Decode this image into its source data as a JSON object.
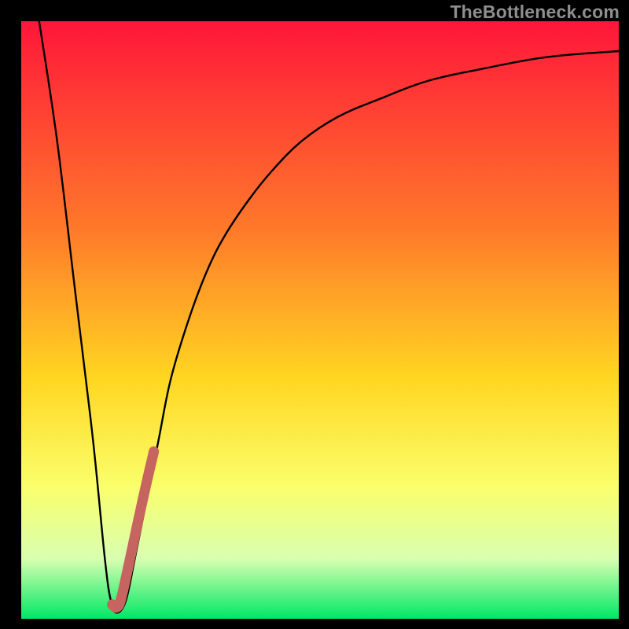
{
  "watermark": "TheBottleneck.com",
  "colors": {
    "frame": "#000000",
    "gradient_top": "#ff163a",
    "gradient_mid1": "#ff7a2a",
    "gradient_mid2": "#ffd722",
    "gradient_mid3": "#faff6c",
    "gradient_mid4": "#d8ffb0",
    "gradient_bottom": "#00e865",
    "curve_main": "#000000",
    "curve_highlight": "#c66460"
  },
  "chart_data": {
    "type": "line",
    "title": "",
    "xlabel": "",
    "ylabel": "",
    "xlim": [
      0,
      100
    ],
    "ylim": [
      0,
      100
    ],
    "grid": false,
    "legend": false,
    "series": [
      {
        "name": "main-curve",
        "color": "#000000",
        "x": [
          3,
          6,
          9,
          12,
          14,
          15,
          16,
          17.5,
          19,
          21,
          23,
          25,
          28,
          31,
          34,
          38,
          42,
          47,
          53,
          60,
          68,
          77,
          88,
          100
        ],
        "y": [
          100,
          80,
          55,
          30,
          10,
          3,
          1,
          3,
          10,
          20,
          30,
          40,
          50,
          58,
          64,
          70,
          75,
          80,
          84,
          87,
          90,
          92,
          94,
          95
        ]
      },
      {
        "name": "highlight-segment",
        "color": "#c66460",
        "x": [
          15.2,
          15.6,
          16.0,
          16.5,
          17.2,
          18.2,
          19.4,
          20.8,
          22.2
        ],
        "y": [
          2.4,
          2.0,
          1.9,
          2.6,
          5.4,
          10.0,
          15.6,
          22.0,
          28.0
        ]
      }
    ]
  }
}
